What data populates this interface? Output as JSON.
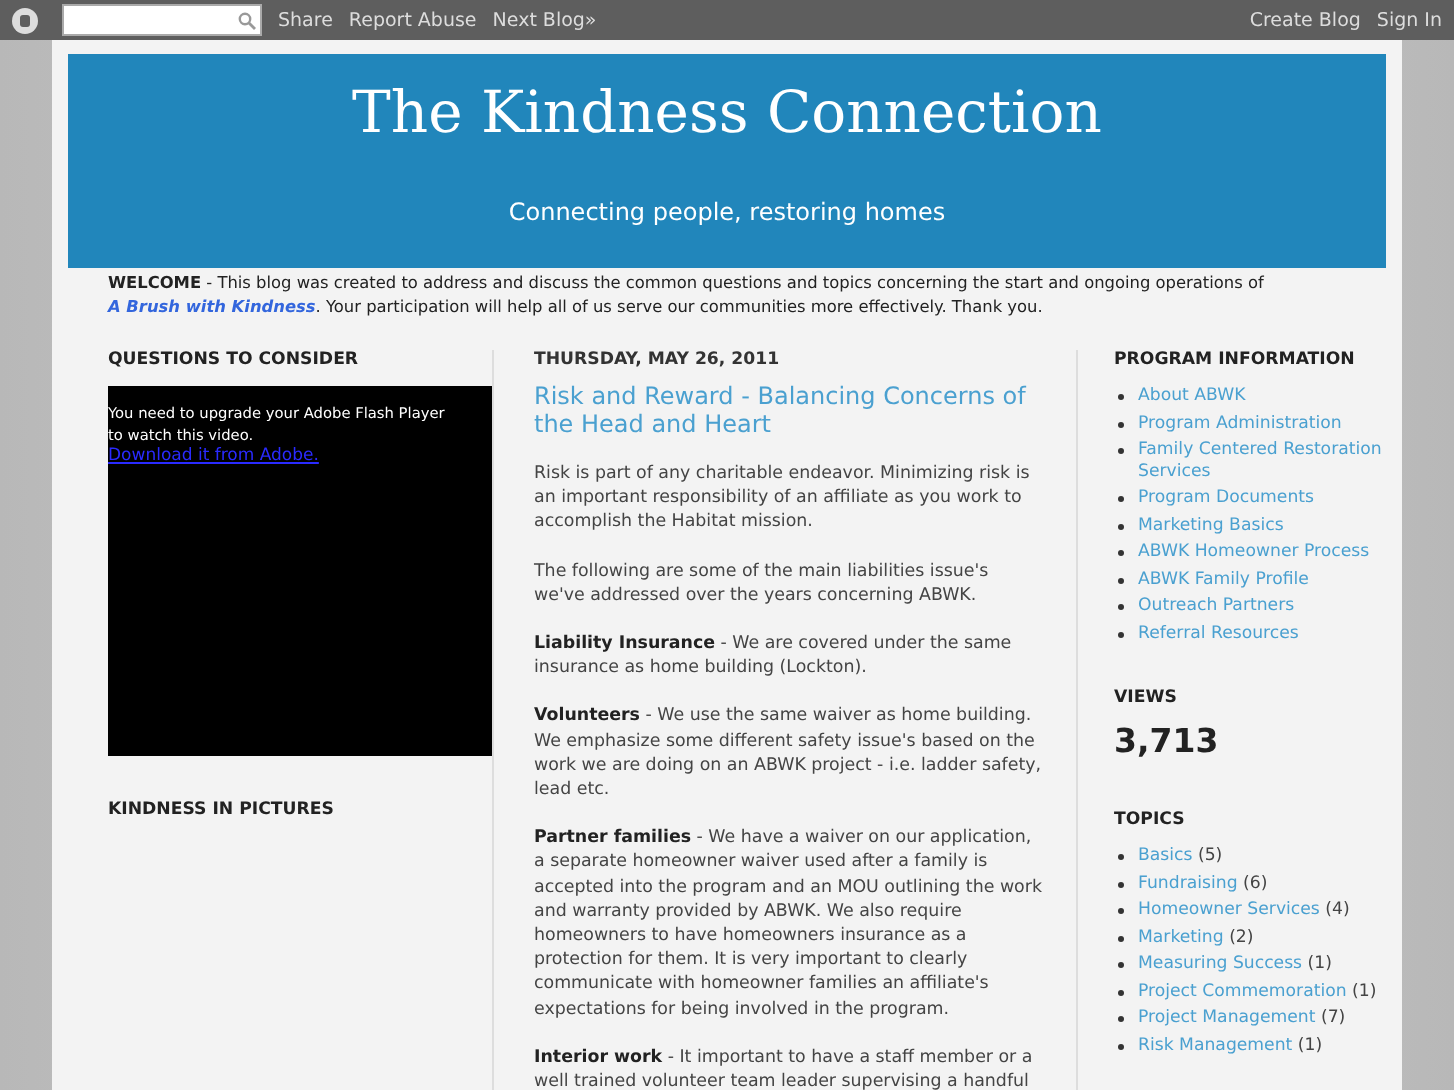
{
  "navbar": {
    "links": [
      "Share",
      "Report Abuse",
      "Next Blog»"
    ],
    "right_links": [
      "Create Blog",
      "Sign In"
    ]
  },
  "header": {
    "title": "The Kindness Connection",
    "description": "Connecting people, restoring homes"
  },
  "welcome": {
    "text": "**WELCOME** - This blog was created to address and discuss the common questions and topics concerning the start and ongoing operations of",
    "link": "A Brush with Kindness",
    "text_after": ". Your participation will help all of us serve our communities more effectively. Thank you."
  },
  "left_sidebar": {
    "sections": [
      {
        "title": "QUESTIONS TO CONSIDER",
        "kind": "video",
        "message_lines": [
          "You need to upgrade your Adobe Flash Player",
          "to watch this video."
        ],
        "link": "Download it from Adobe."
      },
      {
        "title": "KINDNESS IN PICTURES",
        "kind": "empty"
      }
    ]
  },
  "post": {
    "date": "THURSDAY, MAY 26, 2011",
    "title": "Risk and Reward - Balancing Concerns of the Head and Heart",
    "paragraphs": [
      "Risk is part of any charitable endeavor.  Minimizing risk is an important responsibility of an affiliate as you work to accomplish the Habitat mission.",
      "The following are some of the main liabilities issue's we've addressed over the years concerning ABWK.",
      "**Liability Insurance** - We are covered under the same insurance as home building (Lockton).",
      "**Volunteers** - We use the same waiver as home building. We emphasize some different safety issue's based on the work we are doing on an ABWK project - i.e. ladder safety, lead etc.",
      "**Partner families** - We have a waiver on our application, a separate homeowner waiver used after a family is accepted into the program and an MOU outlining the work and warranty provided by ABWK.  We also require homeowners to have homeowners insurance as a protection for them.  It is very important to clearly communicate with homeowner families an affiliate's expectations for being involved in the program.",
      "**Interior work** - It important to have a staff member or a well trained volunteer team leader supervising a handful"
    ]
  },
  "right_sidebar": {
    "program_information": {
      "title": "PROGRAM INFORMATION",
      "items": [
        "About ABWK",
        "Program Administration",
        "Family Centered Restoration Services",
        "Program Documents",
        "Marketing Basics",
        "ABWK Homeowner Process",
        "ABWK Family Profile",
        "Outreach Partners",
        "Referral Resources"
      ]
    },
    "views": {
      "title": "VIEWS",
      "count": "3,713"
    },
    "topics": {
      "title": "TOPICS",
      "items": [
        {
          "label": "Basics",
          "count": "(5)"
        },
        {
          "label": "Fundraising",
          "count": "(6)"
        },
        {
          "label": "Homeowner Services",
          "count": "(4)"
        },
        {
          "label": "Marketing",
          "count": "(2)"
        },
        {
          "label": "Measuring Success",
          "count": "(1)"
        },
        {
          "label": "Project Commemoration",
          "count": "(1)"
        },
        {
          "label": "Project Management",
          "count": "(7)"
        },
        {
          "label": "Risk Management",
          "count": "(1)"
        }
      ]
    }
  }
}
